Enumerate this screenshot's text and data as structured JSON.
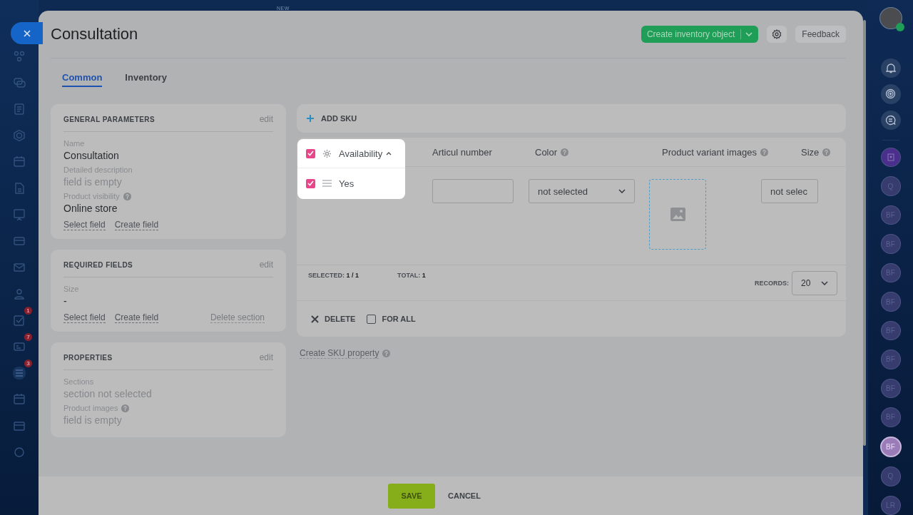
{
  "top_bar": {
    "new_label": "NEW"
  },
  "left_nav": {
    "items": [
      {
        "kind": "circles",
        "selected": false
      },
      {
        "kind": "chat",
        "selected": false
      },
      {
        "kind": "doc",
        "selected": false
      },
      {
        "kind": "hexagon",
        "selected": false
      },
      {
        "kind": "calendar",
        "selected": false
      },
      {
        "kind": "file",
        "selected": false
      },
      {
        "kind": "board",
        "selected": false
      },
      {
        "kind": "card",
        "selected": false
      },
      {
        "kind": "mail",
        "selected": false
      },
      {
        "kind": "people",
        "selected": false
      },
      {
        "kind": "check",
        "selected": false,
        "badge": "1"
      },
      {
        "kind": "id",
        "selected": false,
        "badge": "7"
      },
      {
        "kind": "list",
        "selected": true,
        "badge": "3"
      },
      {
        "kind": "calendar",
        "selected": false
      },
      {
        "kind": "box",
        "selected": false
      },
      {
        "kind": "circle",
        "selected": false
      }
    ]
  },
  "panel": {
    "title": "Consultation",
    "create_button": "Create inventory object",
    "feedback_button": "Feedback",
    "tabs": [
      {
        "label": "Common",
        "selected": true
      },
      {
        "label": "Inventory",
        "selected": false
      }
    ],
    "sections": [
      {
        "title": "GENERAL PARAMETERS",
        "edit": "edit",
        "fields": [
          {
            "label": "Name",
            "value": "Consultation",
            "help": false,
            "empty": false
          },
          {
            "label": "Detailed description",
            "value": "field is empty",
            "help": false,
            "empty": true
          },
          {
            "label": "Product visibility",
            "value": "Online store",
            "help": true,
            "empty": false
          }
        ],
        "links": [
          "Select field",
          "Create field"
        ]
      },
      {
        "title": "REQUIRED FIELDS",
        "edit": "edit",
        "fields": [
          {
            "label": "Size",
            "value": "-",
            "help": false,
            "empty": false
          }
        ],
        "links": [
          "Select field",
          "Create field"
        ],
        "delete_link": "Delete section"
      },
      {
        "title": "PROPERTIES",
        "edit": "edit",
        "fields": [
          {
            "label": "Sections",
            "value": "section not selected",
            "help": false,
            "empty": true
          },
          {
            "label": "Product images",
            "value": "field is empty",
            "help": true,
            "empty": true
          }
        ]
      }
    ],
    "sku": {
      "add_label": "ADD SKU",
      "select_all_checked": true,
      "availability_header": "Availability",
      "columns": [
        {
          "label": "Articul number",
          "help": false
        },
        {
          "label": "Color",
          "help": true
        },
        {
          "label": "Product variant images",
          "help": true
        },
        {
          "label": "Size",
          "help": true
        }
      ],
      "rows": [
        {
          "checked": true,
          "availability": "Yes",
          "color_value": "not selected",
          "size": "not selec"
        }
      ],
      "selected_label": "SELECTED:",
      "selected_value": "1 / 1",
      "total_label": "TOTAL:",
      "total_value": "1",
      "records_label": "RECORDS:",
      "records_value": "20",
      "delete_label": "DELETE",
      "for_all": {
        "label": "FOR ALL",
        "checked": false
      }
    },
    "create_property": "Create SKU property",
    "save": "SAVE",
    "cancel": "CANCEL"
  },
  "right_bar": {
    "items": [
      {
        "kind": "icon",
        "selected": false
      },
      {
        "kind": "initials",
        "initials": "Q",
        "selected": false
      },
      {
        "kind": "initials",
        "initials": "BF",
        "selected": false
      },
      {
        "kind": "initials",
        "initials": "BF",
        "selected": false
      },
      {
        "kind": "initials",
        "initials": "BF",
        "selected": false
      },
      {
        "kind": "initials",
        "initials": "BF",
        "selected": false
      },
      {
        "kind": "initials",
        "initials": "BF",
        "selected": false
      },
      {
        "kind": "initials",
        "initials": "BF",
        "selected": false
      },
      {
        "kind": "initials",
        "initials": "BF",
        "selected": false
      },
      {
        "kind": "initials",
        "initials": "BF",
        "selected": false
      },
      {
        "kind": "initials",
        "initials": "BF",
        "selected": true
      },
      {
        "kind": "initials",
        "initials": "Q",
        "selected": false
      },
      {
        "kind": "initials",
        "initials": "LR",
        "selected": false
      }
    ]
  }
}
